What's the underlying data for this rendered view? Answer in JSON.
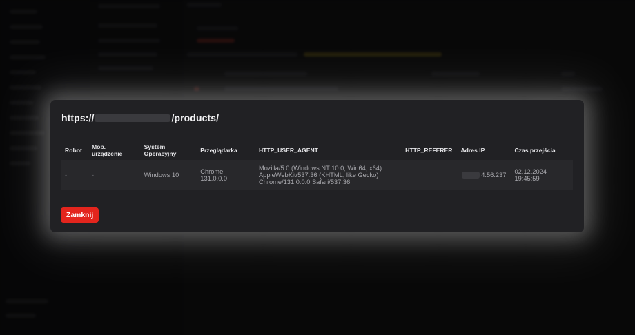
{
  "modal": {
    "url_prefix": "https://",
    "url_suffix": "/products/",
    "close_label": "Zamknij"
  },
  "table": {
    "headers": [
      "Robot",
      "Mob. urządzenie",
      "System Operacyjny",
      "Przeglądarka",
      "HTTP_USER_AGENT",
      "HTTP_REFERER",
      "Adres IP",
      "Czas przejścia"
    ],
    "rows": [
      {
        "robot": "-",
        "mobile": "-",
        "os": "Windows 10",
        "browser": "Chrome 131.0.0.0",
        "user_agent": "Mozilla/5.0 (Windows NT 10.0; Win64; x64) AppleWebKit/537.36 (KHTML, like Gecko) Chrome/131.0.0.0 Safari/537.36",
        "referer": "",
        "ip_visible": "4.56.237",
        "time_date": "02.12.2024",
        "time_clock": "19:45:59"
      }
    ]
  },
  "colors": {
    "modal_bg": "#212124",
    "row_bg": "#28282b",
    "button_bg": "#e3251d"
  }
}
